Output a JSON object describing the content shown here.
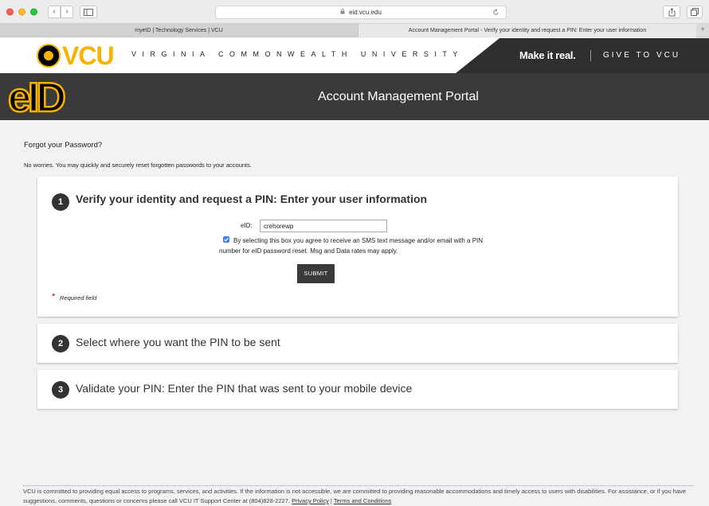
{
  "browser": {
    "url": "eid.vcu.edu",
    "tabs": [
      {
        "label": "myeID | Technology Services | VCU"
      },
      {
        "label": "Account Management Portal - Verify your identity and request a PIN: Enter your user information"
      }
    ],
    "new_tab_glyph": "+",
    "back_glyph": "‹",
    "forward_glyph": "›"
  },
  "brand": {
    "logo_text": "VCU",
    "university_name": "VIRGINIA COMMONWEALTH UNIVERSITY",
    "make_it_real": "Make it real.",
    "give": "GIVE TO VCU",
    "accent_color": "#f8b300",
    "dark_color": "#3a3a3a"
  },
  "header": {
    "eid_logo_text": "eID",
    "portal_title": "Account Management Portal"
  },
  "intro": {
    "title": "Forgot your Password?",
    "description": "No worries. You may quickly and securely reset forgotten passwords to your accounts."
  },
  "steps": [
    {
      "number": "1",
      "title": "Verify your identity and request a PIN: Enter your user information",
      "eid_label": "eID:",
      "eid_value": "crehorewp",
      "agree_checked": true,
      "agree_text": "By selecting this box you agree to receive an SMS text message and/or email with a PIN number for eID password reset. Msg and Data rates may apply.",
      "submit_label": "SUBMIT",
      "required_star": "*",
      "required_text": "Required field"
    },
    {
      "number": "2",
      "title": "Select where you want the PIN to be sent"
    },
    {
      "number": "3",
      "title": "Validate your PIN: Enter the PIN that was sent to your mobile device"
    }
  ],
  "footer": {
    "text": "VCU is committed to providing equal access to programs, services, and activities. If the information is not accessible, we are committed to providing reasonable accommodations and timely access to users with disabilities. For assistance, or if you have suggestions, comments, questions or concerns please call VCU IT Support Center at (804)828-2227.",
    "privacy_link": "Privacy Policy",
    "separator": "|",
    "terms_link": "Terms and Conditions"
  }
}
